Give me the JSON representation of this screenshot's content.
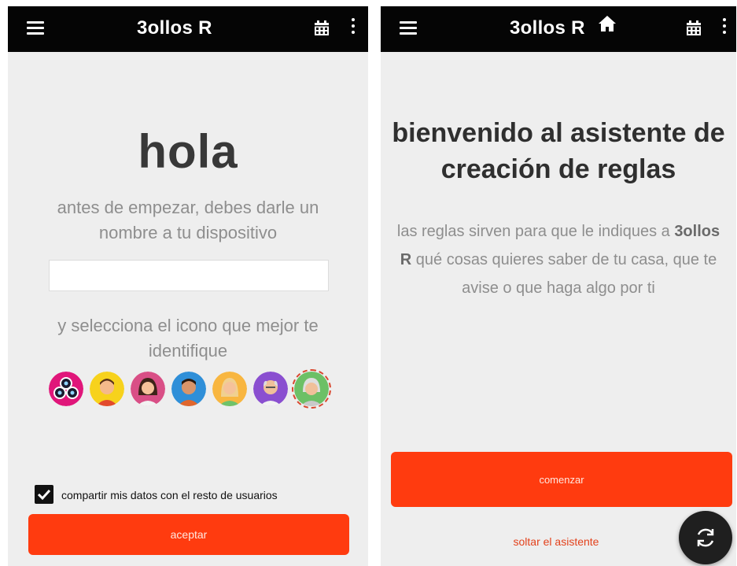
{
  "left_screen": {
    "app_title": "3ollos R",
    "greeting": "hola",
    "intro_text": "antes de empezar, debes darle un nombre a tu dispositivo",
    "name_input": {
      "value": "",
      "placeholder": ""
    },
    "select_icon_text": "y selecciona el icono que mejor te identifique",
    "avatars": [
      "logo-avatar-icon",
      "boy-avatar-icon",
      "woman-avatar-icon",
      "man-avatar-icon",
      "girl-avatar-icon",
      "grandpa-avatar-icon",
      "grandma-avatar-icon"
    ],
    "selected_avatar": "grandma-avatar-icon",
    "share_checkbox": {
      "label": "compartir mis datos con el resto de usuarios",
      "checked": true
    },
    "accept_button": "aceptar"
  },
  "right_screen": {
    "app_title": "3ollos R",
    "welcome_title": "bienvenido al asistente de creación de reglas",
    "rules_text": {
      "part1": "las reglas sirven para que le indiques a",
      "brand": "3ollos R",
      "part2": "qué cosas quieres saber de tu casa, que te avise o que haga algo por ti"
    },
    "start_button": "comenzar",
    "skip_link": "soltar el asistente"
  },
  "icons": [
    "menu-icon",
    "home-icon",
    "calendar-icon",
    "more-vert-icon",
    "refresh-icon"
  ],
  "colors": {
    "topbar": "#050505",
    "background": "#eeeeee",
    "accent": "#ff3b0f",
    "link": "#e3421c"
  }
}
